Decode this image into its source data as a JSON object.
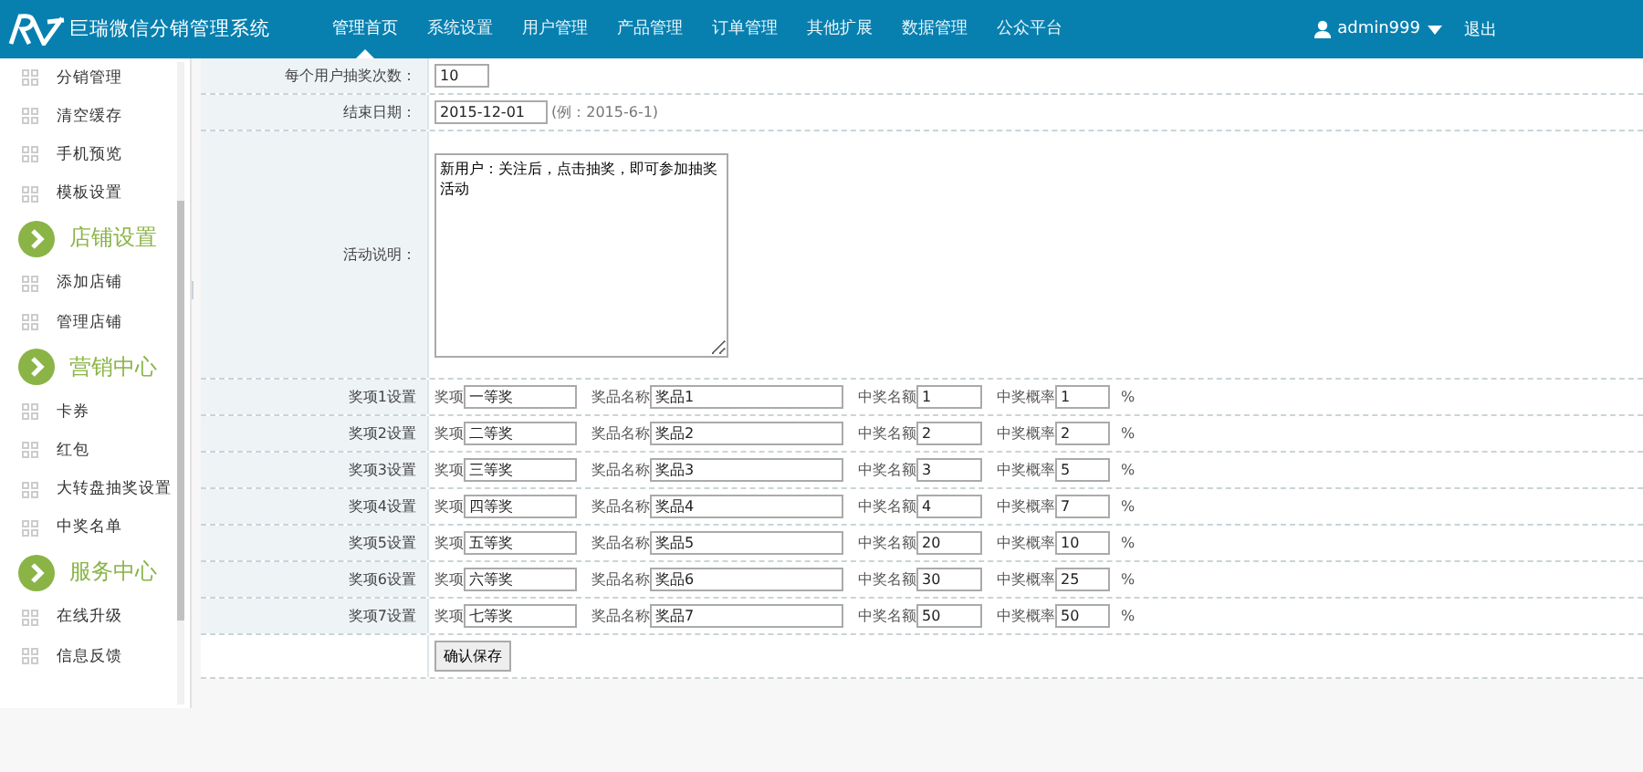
{
  "header": {
    "logo_text": "巨瑞微信分销管理系统",
    "nav": [
      {
        "label": "管理首页",
        "selected": true
      },
      {
        "label": "系统设置",
        "selected": false
      },
      {
        "label": "用户管理",
        "selected": false
      },
      {
        "label": "产品管理",
        "selected": false
      },
      {
        "label": "订单管理",
        "selected": false
      },
      {
        "label": "其他扩展",
        "selected": false
      },
      {
        "label": "数据管理",
        "selected": false
      },
      {
        "label": "公众平台",
        "selected": false
      }
    ],
    "user": "admin999",
    "logout": "退出"
  },
  "sidebar": {
    "items": [
      {
        "kind": "item",
        "label": "分销管理"
      },
      {
        "kind": "item",
        "label": "清空缓存"
      },
      {
        "kind": "item",
        "label": "手机预览"
      },
      {
        "kind": "item",
        "label": "模板设置"
      },
      {
        "kind": "section",
        "label": "店铺设置"
      },
      {
        "kind": "item",
        "label": "添加店铺"
      },
      {
        "kind": "item",
        "label": "管理店铺"
      },
      {
        "kind": "section",
        "label": "营销中心"
      },
      {
        "kind": "item",
        "label": "卡券"
      },
      {
        "kind": "item",
        "label": "红包"
      },
      {
        "kind": "item",
        "label": "大转盘抽奖设置"
      },
      {
        "kind": "item",
        "label": "中奖名单"
      },
      {
        "kind": "section",
        "label": "服务中心"
      },
      {
        "kind": "item",
        "label": "在线升级"
      },
      {
        "kind": "item",
        "label": "信息反馈"
      }
    ]
  },
  "form": {
    "draws": {
      "label": "每个用户抽奖次数：",
      "value": "10"
    },
    "end_date": {
      "label": "结束日期：",
      "value": "2015-12-01",
      "hint": "(例：2015-6-1)"
    },
    "description": {
      "label": "活动说明：",
      "value": "新用户：关注后，点击抽奖，即可参加抽奖活动"
    },
    "prizes": [
      {
        "label": "奖项1设置",
        "level_label": "奖项",
        "level": "一等奖",
        "name_label": "奖品名称",
        "name": "奖品1",
        "count_label": "中奖名额",
        "count": "1",
        "rate_label": "中奖概率",
        "rate": "1",
        "unit": "%"
      },
      {
        "label": "奖项2设置",
        "level_label": "奖项",
        "level": "二等奖",
        "name_label": "奖品名称",
        "name": "奖品2",
        "count_label": "中奖名额",
        "count": "2",
        "rate_label": "中奖概率",
        "rate": "2",
        "unit": "%"
      },
      {
        "label": "奖项3设置",
        "level_label": "奖项",
        "level": "三等奖",
        "name_label": "奖品名称",
        "name": "奖品3",
        "count_label": "中奖名额",
        "count": "3",
        "rate_label": "中奖概率",
        "rate": "5",
        "unit": "%"
      },
      {
        "label": "奖项4设置",
        "level_label": "奖项",
        "level": "四等奖",
        "name_label": "奖品名称",
        "name": "奖品4",
        "count_label": "中奖名额",
        "count": "4",
        "rate_label": "中奖概率",
        "rate": "7",
        "unit": "%"
      },
      {
        "label": "奖项5设置",
        "level_label": "奖项",
        "level": "五等奖",
        "name_label": "奖品名称",
        "name": "奖品5",
        "count_label": "中奖名额",
        "count": "20",
        "rate_label": "中奖概率",
        "rate": "10",
        "unit": "%"
      },
      {
        "label": "奖项6设置",
        "level_label": "奖项",
        "level": "六等奖",
        "name_label": "奖品名称",
        "name": "奖品6",
        "count_label": "中奖名额",
        "count": "30",
        "rate_label": "中奖概率",
        "rate": "25",
        "unit": "%"
      },
      {
        "label": "奖项7设置",
        "level_label": "奖项",
        "level": "七等奖",
        "name_label": "奖品名称",
        "name": "奖品7",
        "count_label": "中奖名额",
        "count": "50",
        "rate_label": "中奖概率",
        "rate": "50",
        "unit": "%"
      }
    ],
    "submit": "确认保存"
  }
}
